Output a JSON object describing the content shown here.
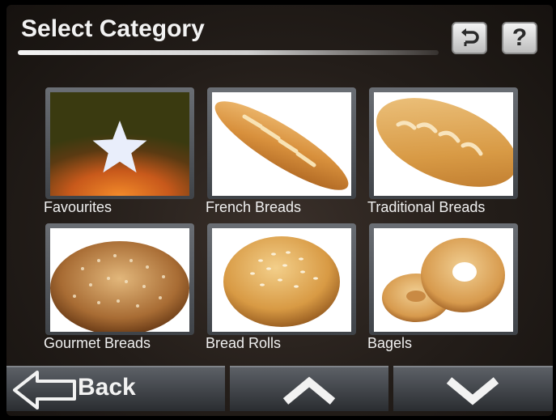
{
  "header": {
    "title": "Select Category",
    "back_icon": "return-arrow-icon",
    "help_label": "?"
  },
  "categories": [
    {
      "label": "Favourites",
      "image": "star-icon"
    },
    {
      "label": "French Breads",
      "image": "baguette-image"
    },
    {
      "label": "Traditional Breads",
      "image": "loaf-image"
    },
    {
      "label": "Gourmet Breads",
      "image": "round-loaf-image"
    },
    {
      "label": "Bread Rolls",
      "image": "bread-roll-image"
    },
    {
      "label": "Bagels",
      "image": "bagels-image"
    }
  ],
  "footer": {
    "back_label": "Back",
    "up_icon": "chevron-up-icon",
    "down_icon": "chevron-down-icon"
  },
  "colors": {
    "background": "#231d19",
    "text": "#f2f2f2",
    "favourites_glow": "#e8751f"
  }
}
